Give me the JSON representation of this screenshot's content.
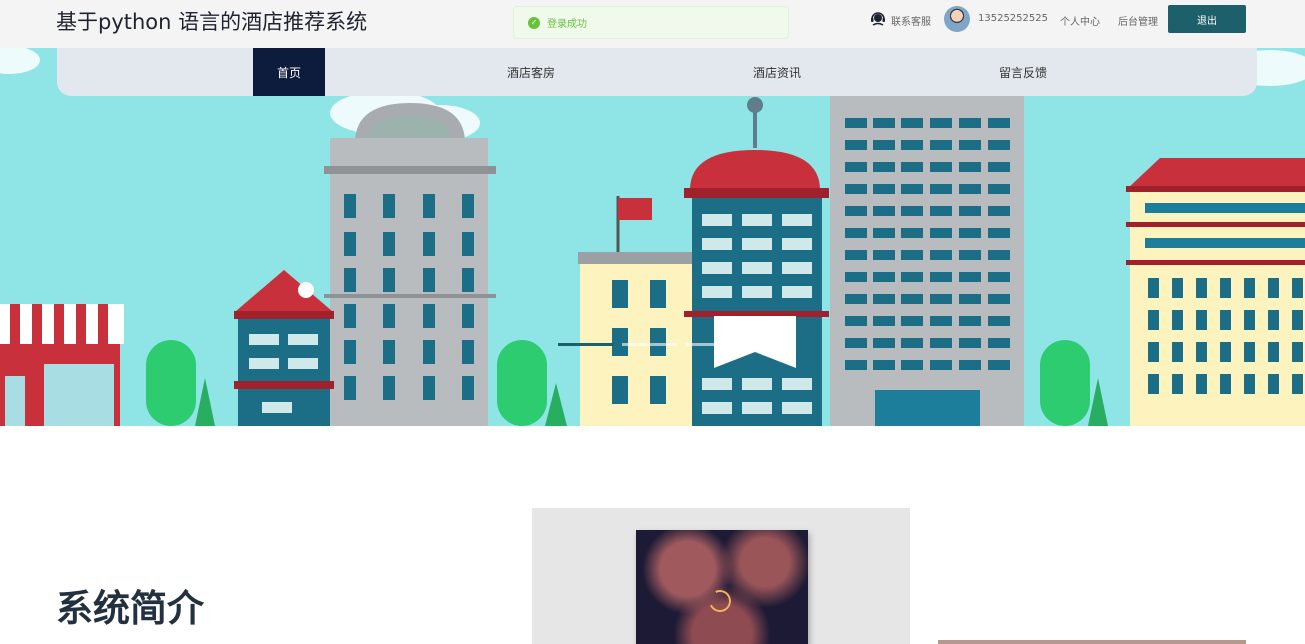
{
  "header": {
    "site_title": "基于python 语言的酒店推荐系统",
    "toast": {
      "text": "登录成功",
      "icon": "check-circle-icon",
      "color": "#67c23a"
    },
    "customer_service": "联系客服",
    "phone": "13525252525",
    "personal_center": "个人中心",
    "admin": "后台管理",
    "logout": "退出"
  },
  "nav": {
    "items": [
      {
        "label": "首页",
        "active": true
      },
      {
        "label": "酒店客房",
        "active": false
      },
      {
        "label": "酒店资讯",
        "active": false
      },
      {
        "label": "留言反馈",
        "active": false
      }
    ]
  },
  "banner": {
    "slide_count": 3,
    "active_slide": 1
  },
  "intro": {
    "title": "系统简介"
  },
  "colors": {
    "accent": "#1d5f6b",
    "nav_active": "#0d1b3d",
    "sky": "#8fe4e6"
  }
}
